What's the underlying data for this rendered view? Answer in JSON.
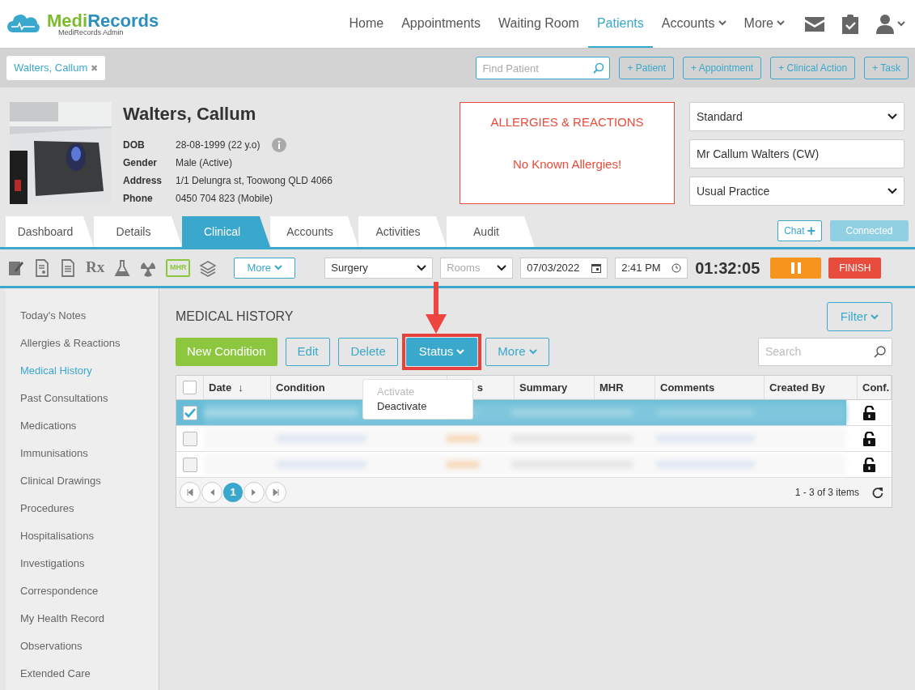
{
  "app": {
    "brand_a": "Medi",
    "brand_b": "Records",
    "subtitle": "MediRecords Admin"
  },
  "nav": [
    {
      "label": "Home",
      "selected": false,
      "dropdown": false
    },
    {
      "label": "Appointments",
      "selected": false,
      "dropdown": false
    },
    {
      "label": "Waiting Room",
      "selected": false,
      "dropdown": false
    },
    {
      "label": "Patients",
      "selected": true,
      "dropdown": false
    },
    {
      "label": "Accounts",
      "selected": false,
      "dropdown": true
    },
    {
      "label": "More",
      "selected": false,
      "dropdown": true
    }
  ],
  "open_patients": [
    {
      "label": "Walters, Callum",
      "close": "✖"
    }
  ],
  "find_patient": {
    "placeholder": "Find Patient"
  },
  "quick_buttons": [
    "+ Patient",
    "+ Appointment",
    "+ Clinical Action",
    "+ Task"
  ],
  "patient": {
    "name": "Walters, Callum",
    "fields": [
      {
        "label": "DOB",
        "value": "28-08-1999 (22 y.o)"
      },
      {
        "label": "Gender",
        "value": "Male (Active)"
      },
      {
        "label": "Address",
        "value": "1/1 Delungra st, Toowong QLD 4066"
      },
      {
        "label": "Phone",
        "value": "0450 704 823 (Mobile)"
      }
    ]
  },
  "allergies": {
    "title": "ALLERGIES & REACTIONS",
    "message": "No Known Allergies!"
  },
  "patient_settings": [
    {
      "kind": "select",
      "value": "Standard"
    },
    {
      "kind": "text",
      "value": "Mr Callum Walters (CW)"
    },
    {
      "kind": "select",
      "value": "Usual Practice"
    }
  ],
  "tabs": [
    {
      "label": "Dashboard",
      "selected": false
    },
    {
      "label": "Details",
      "selected": false
    },
    {
      "label": "Clinical",
      "selected": true
    },
    {
      "label": "Accounts",
      "selected": false
    },
    {
      "label": "Activities",
      "selected": false
    },
    {
      "label": "Audit",
      "selected": false
    }
  ],
  "chat": {
    "label": "Chat",
    "icon": "+"
  },
  "connection": {
    "label": "Connected"
  },
  "toolbar": {
    "rx_label": "Rx",
    "mhr_label": "MHR",
    "more": "More",
    "location": "Surgery",
    "rooms_placeholder": "Rooms",
    "date": "07/03/2022",
    "time": "2:41 PM",
    "timer": "01:32:05",
    "finish": "FINISH"
  },
  "sidebar": {
    "items": [
      {
        "label": "Today's Notes",
        "selected": false
      },
      {
        "label": "Allergies & Reactions",
        "selected": false
      },
      {
        "label": "Medical History",
        "selected": true
      },
      {
        "label": "Past Consultations",
        "selected": false
      },
      {
        "label": "Medications",
        "selected": false
      },
      {
        "label": "Immunisations",
        "selected": false
      },
      {
        "label": "Clinical Drawings",
        "selected": false
      },
      {
        "label": "Procedures",
        "selected": false
      },
      {
        "label": "Hospitalisations",
        "selected": false
      },
      {
        "label": "Investigations",
        "selected": false
      },
      {
        "label": "Correspondence",
        "selected": false
      },
      {
        "label": "My Health Record",
        "selected": false
      },
      {
        "label": "Observations",
        "selected": false
      },
      {
        "label": "Extended Care",
        "selected": false
      }
    ]
  },
  "section": {
    "title": "MEDICAL HISTORY",
    "filter": "Filter",
    "actions": [
      {
        "label": "New Condition",
        "kind": "primary",
        "highlighted": false
      },
      {
        "label": "Edit",
        "kind": "outline",
        "highlighted": false
      },
      {
        "label": "Delete",
        "kind": "outline",
        "highlighted": false
      },
      {
        "label": "Status",
        "kind": "dropdown",
        "highlighted": true
      },
      {
        "label": "More",
        "kind": "outline-dropdown",
        "highlighted": false
      }
    ],
    "search": {
      "placeholder": "Search"
    },
    "status_menu": [
      {
        "label": "Activate",
        "disabled": true
      },
      {
        "label": "Deactivate",
        "disabled": false
      }
    ]
  },
  "table": {
    "all_checked": false,
    "columns": [
      {
        "label": "Date",
        "sort": "↓"
      },
      {
        "label": "Condition"
      },
      {
        "label": "s"
      },
      {
        "label": "Summary"
      },
      {
        "label": "MHR"
      },
      {
        "label": "Comments"
      },
      {
        "label": "Created By"
      },
      {
        "label": "Conf."
      }
    ],
    "rows": [
      {
        "selected": true,
        "checked": true
      },
      {
        "selected": false,
        "checked": false
      },
      {
        "selected": false,
        "checked": false
      }
    ],
    "pages": [
      {
        "label": "1",
        "selected": true
      }
    ],
    "summary": "1 - 3 of 3 items"
  }
}
